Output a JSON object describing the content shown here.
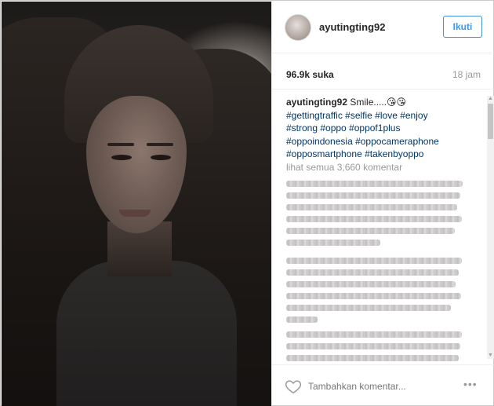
{
  "post": {
    "username": "ayutingting92",
    "follow_label": "Ikuti",
    "likes": "96.9k suka",
    "time": "18 jam",
    "caption": {
      "user": "ayutingting92",
      "text": "Smile.....😘😘",
      "hashtags": [
        "#gettingtraffic #selfie #love #enjoy",
        "#strong #oppo #oppof1plus",
        "#oppoindonesia #oppocameraphone",
        "#opposmartphone #takenbyoppo"
      ]
    },
    "view_all_comments": "lihat semua 3,660 komentar",
    "comment_placeholder": "Tambahkan komentar...",
    "more_label": "•••"
  },
  "icons": {
    "heart": "heart-icon",
    "more": "more-options-icon"
  },
  "colors": {
    "accent": "#3897f0",
    "hashtag": "#003569",
    "muted": "#999999"
  }
}
